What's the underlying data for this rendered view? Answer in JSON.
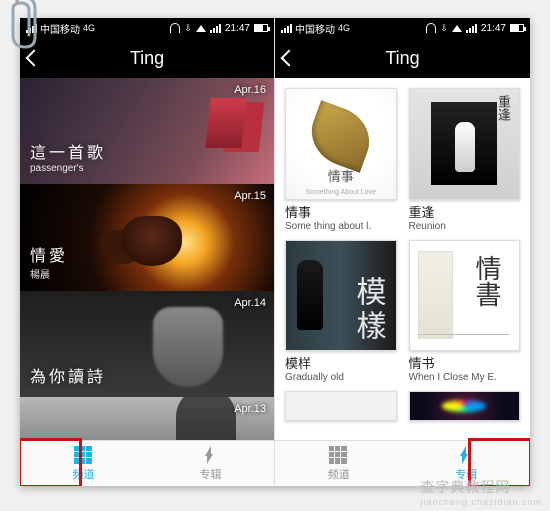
{
  "status": {
    "carrier": "中国移动",
    "network": "4G",
    "time_left": "21:47",
    "time_right": "21:47"
  },
  "header": {
    "title": "Ting"
  },
  "feed": [
    {
      "date": "Apr.16",
      "line1": "這一首歌",
      "line2": "passenger's"
    },
    {
      "date": "Apr.15",
      "line1": "情愛",
      "line2": "楊晨"
    },
    {
      "date": "Apr.14",
      "line1": "為你讀詩",
      "line2": ""
    },
    {
      "date": "Apr.13",
      "line1": "",
      "line2": ""
    }
  ],
  "albums": [
    {
      "cover_label": "情事",
      "cover_sub": "Something About Love",
      "title": "情事",
      "sub": "Some thing about l."
    },
    {
      "cover_label": "重逢",
      "cover_sub": "",
      "title": "重逢",
      "sub": "Reunion"
    },
    {
      "cover_label": "模樣",
      "cover_sub": "",
      "title": "模样",
      "sub": "Gradually old"
    },
    {
      "cover_label": "情書",
      "cover_sub": "",
      "title": "情书",
      "sub": "When I Close My E."
    }
  ],
  "tabs": {
    "channel": "频道",
    "album": "专辑"
  },
  "watermark": {
    "main": "查字典教程网",
    "sub": "jiaocheng.chazidian.com"
  }
}
